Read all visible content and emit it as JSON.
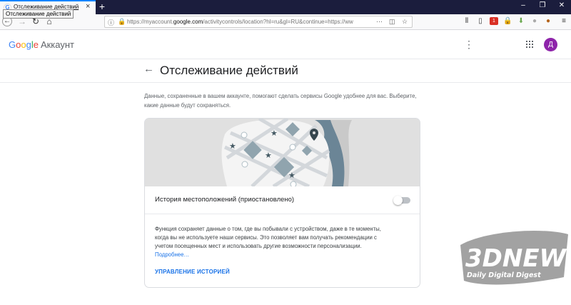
{
  "browser": {
    "tab_title": "Отслеживание действий",
    "tab_favicon": "G",
    "tooltip": "Отслеживание действий",
    "url_prefix": "https://myaccount.",
    "url_domain": "google.com",
    "url_rest": "/activitycontrols/location?hl=ru&gl=RU&continue=https://ww",
    "badge_count": "1"
  },
  "header": {
    "logo": "Google",
    "logo_suffix": "Аккаунт",
    "avatar_letter": "Д"
  },
  "page": {
    "title": "Отслеживание действий",
    "intro": "Данные, сохраненные в вашем аккаунте, помогают сделать сервисы Google удобнее для вас. Выберите, какие данные будут сохраняться."
  },
  "card": {
    "setting_label": "История местоположений (приостановлено)",
    "toggle_on": false,
    "description": "Функция сохраняет данные о том, где вы побывали с устройством, даже в те моменты, когда вы не используете наши сервисы. Это позволяет вам получать рекомендации с учетом посещенных мест и использовать другие возможности персонализации.",
    "more_link": "Подробнее…",
    "manage_link": "УПРАВЛЕНИЕ ИСТОРИЕЙ"
  },
  "watermark": {
    "brand": "3DNEWS",
    "tagline": "Daily Digital Digest"
  },
  "colors": {
    "accent": "#1a73e8",
    "avatar": "#8e24aa",
    "tab_bar": "#1b1d3d",
    "secure": "#12bc00"
  }
}
